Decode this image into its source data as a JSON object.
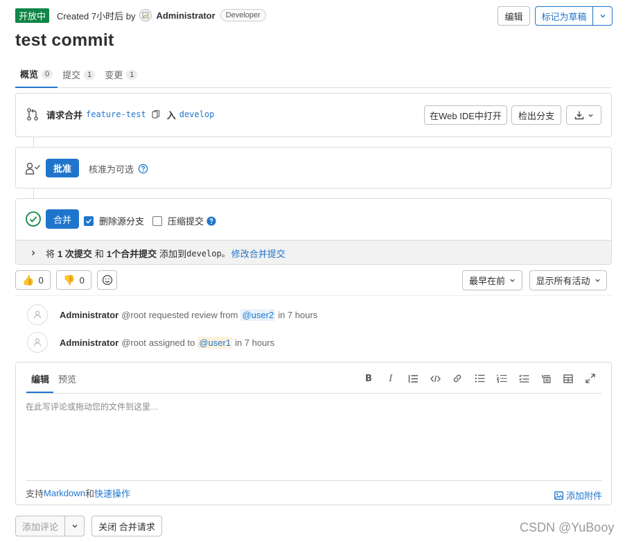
{
  "header": {
    "status": "开放中",
    "created_text": "Created 7小时后 by",
    "author": "Administrator",
    "role": "Developer",
    "edit_button": "编辑",
    "draft_button": "标记为草稿"
  },
  "title": "test commit",
  "tabs": [
    {
      "label": "概览",
      "count": "0"
    },
    {
      "label": "提交",
      "count": "1"
    },
    {
      "label": "变更",
      "count": "1"
    }
  ],
  "merge_request": {
    "label": "请求合并",
    "source_branch": "feature-test",
    "into_text": "入",
    "target_branch": "develop",
    "open_webide": "在Web IDE中打开",
    "checkout": "检出分支"
  },
  "approval": {
    "approve_button": "批准",
    "optional_text": "核准为可选"
  },
  "merge": {
    "merge_button": "合并",
    "delete_source": "删除源分支",
    "delete_source_checked": true,
    "squash": "压缩提交",
    "squash_checked": false,
    "info_prefix": "将",
    "info_commits": "1 次提交",
    "info_and": "和",
    "info_merge_commits": "1个合并提交",
    "info_added_to": "添加到",
    "info_branch": "develop。",
    "modify_link": "修改合并提交"
  },
  "reactions": {
    "thumbs_up": "0",
    "thumbs_down": "0",
    "sort": "最早在前",
    "filter": "显示所有活动"
  },
  "activities": [
    {
      "name": "Administrator",
      "handle": "@root",
      "action": "requested review from",
      "mention": "@user2",
      "time": "in 7 hours"
    },
    {
      "name": "Administrator",
      "handle": "@root",
      "action": "assigned to",
      "mention": "@user1",
      "time": "in 7 hours"
    }
  ],
  "editor": {
    "tab_write": "编辑",
    "tab_preview": "预览",
    "placeholder": "在此写评论或拖动您的文件到这里…",
    "footer_support": "支持",
    "footer_markdown": "Markdown",
    "footer_and": "和",
    "footer_quick": "快速操作",
    "attach": "添加附件"
  },
  "actions": {
    "add_comment": "添加评论",
    "close_mr": "关闭 合并请求"
  },
  "watermark": "CSDN @YuBooy",
  "colors": {
    "accent": "#1f75cb",
    "status_open": "#108548",
    "success": "#108548"
  }
}
